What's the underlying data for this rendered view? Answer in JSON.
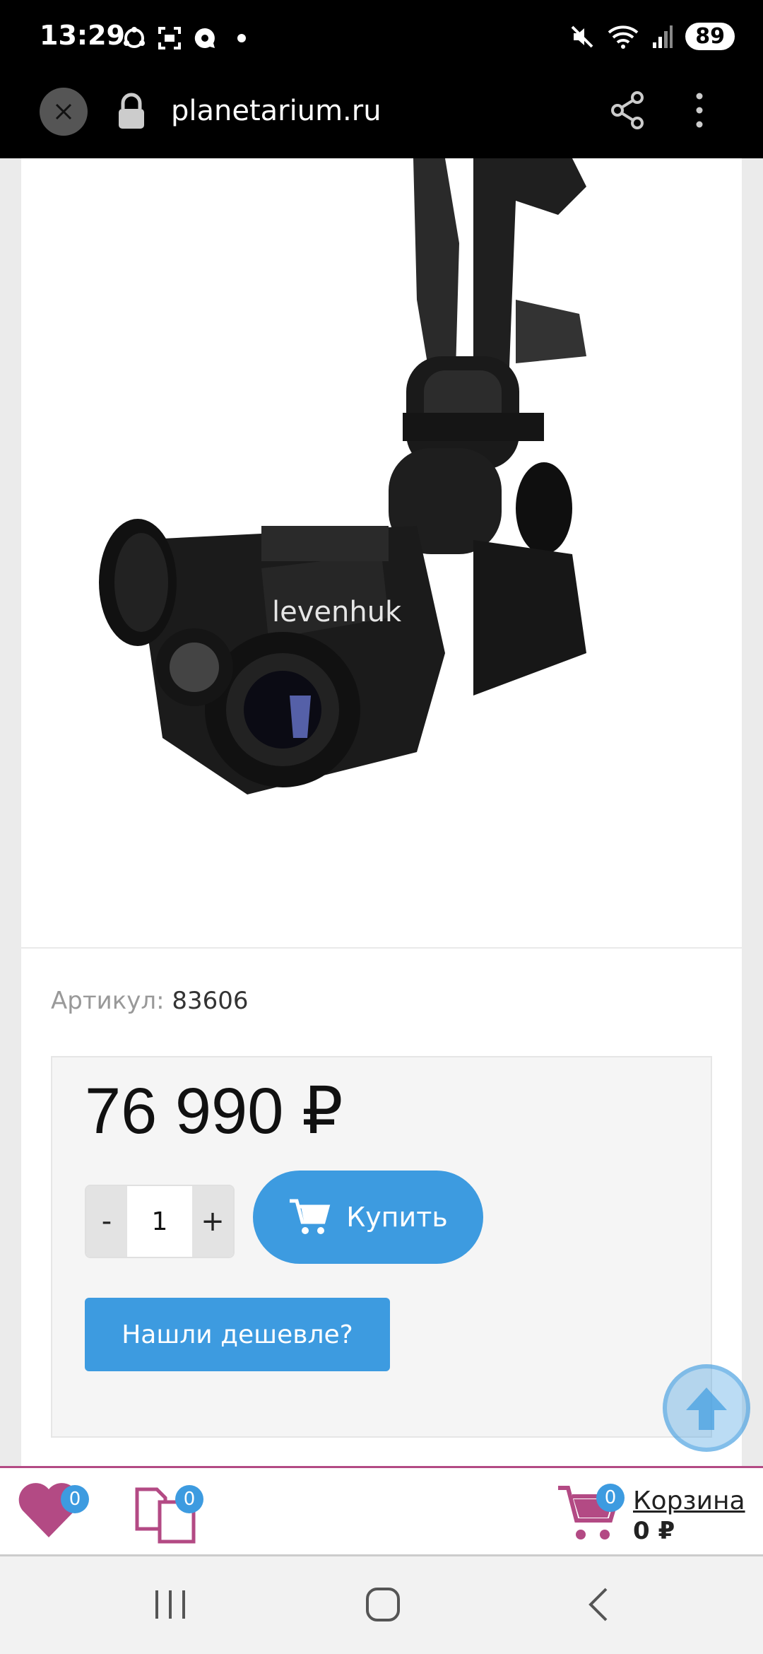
{
  "status": {
    "time": "13:29",
    "battery": "89"
  },
  "browser": {
    "url": "planetarium.ru"
  },
  "product": {
    "brand_on_image": "levenhuk",
    "sku_label": "Артикул:",
    "sku_value": "83606",
    "price": "76 990 ₽",
    "quantity": "1",
    "qty_minus": "-",
    "qty_plus": "+",
    "buy_label": "Купить",
    "cheaper_label": "Нашли дешевле?"
  },
  "bottom_bar": {
    "favorites_count": "0",
    "compare_count": "0",
    "cart_count": "0",
    "cart_label": "Корзина",
    "cart_total": "0 ₽"
  },
  "colors": {
    "accent": "#3d9be0",
    "brand_pink": "#b34a84"
  }
}
